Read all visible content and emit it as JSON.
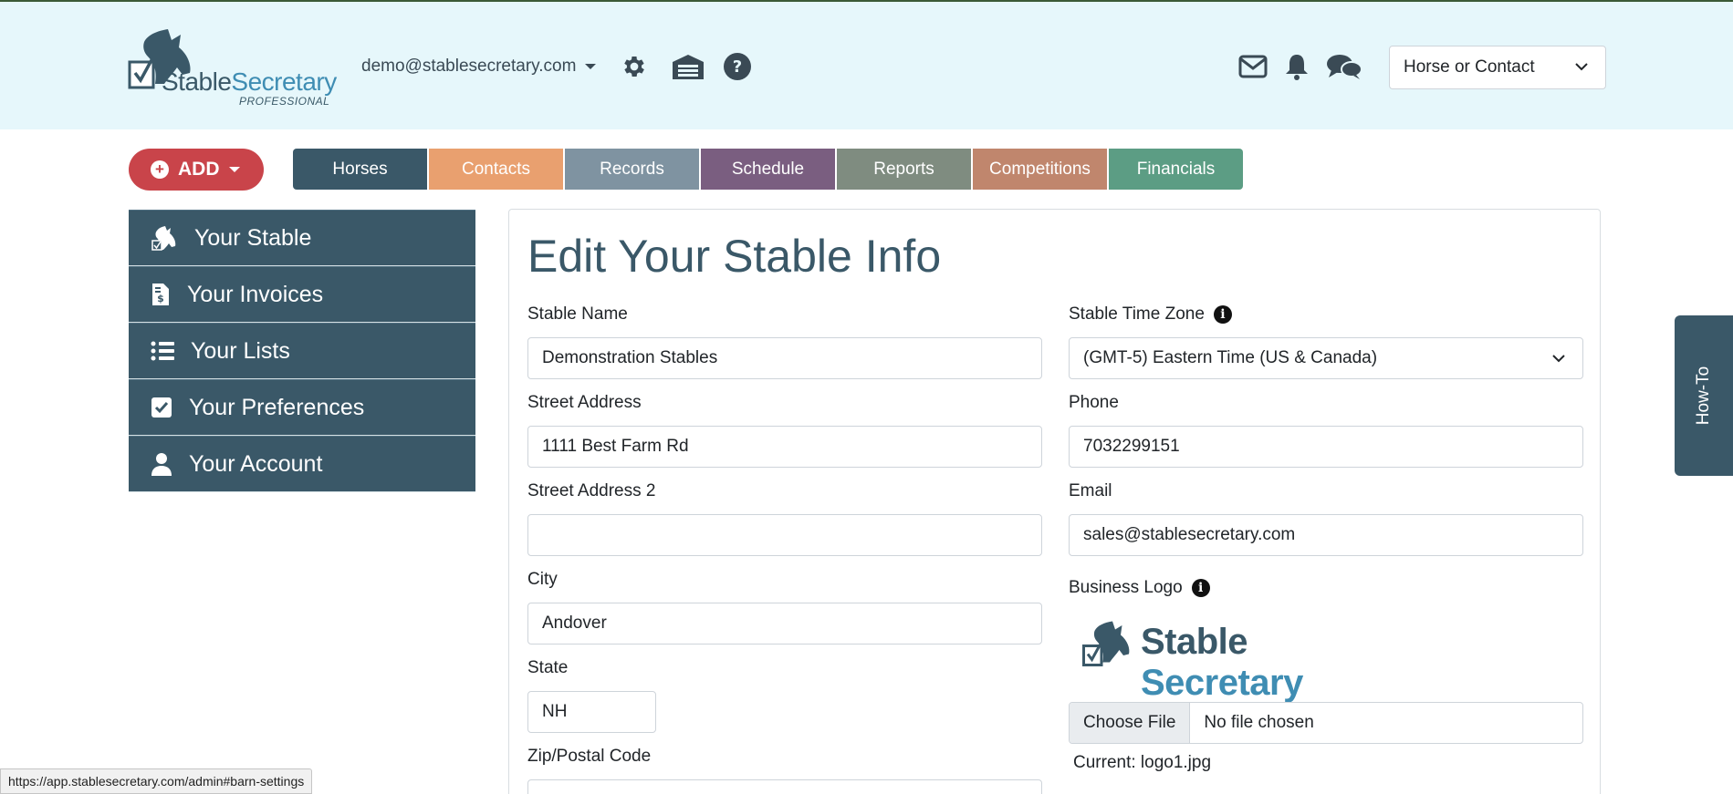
{
  "header": {
    "logo": {
      "part1": "Stable",
      "part2": "Secretary",
      "sub": "PROFESSIONAL"
    },
    "user_email": "demo@stablesecretary.com",
    "search_select": "Horse or Contact"
  },
  "toolbar": {
    "add_label": "ADD",
    "tabs": [
      {
        "label": "Horses",
        "color": "#3a5868"
      },
      {
        "label": "Contacts",
        "color": "#e9a06f"
      },
      {
        "label": "Records",
        "color": "#7f93a1"
      },
      {
        "label": "Schedule",
        "color": "#7a5e80"
      },
      {
        "label": "Reports",
        "color": "#7f8c80"
      },
      {
        "label": "Competitions",
        "color": "#c0866d"
      },
      {
        "label": "Financials",
        "color": "#5c9d84"
      }
    ]
  },
  "sidebar": {
    "items": [
      {
        "label": "Your Stable"
      },
      {
        "label": "Your Invoices"
      },
      {
        "label": "Your Lists"
      },
      {
        "label": "Your Preferences"
      },
      {
        "label": "Your Account"
      }
    ]
  },
  "form": {
    "title": "Edit Your Stable Info",
    "stable_name": {
      "label": "Stable Name",
      "value": "Demonstration Stables"
    },
    "street_address": {
      "label": "Street Address",
      "value": "1111 Best Farm Rd"
    },
    "street_address_2": {
      "label": "Street Address 2",
      "value": ""
    },
    "city": {
      "label": "City",
      "value": "Andover"
    },
    "state": {
      "label": "State",
      "value": "NH"
    },
    "zip": {
      "label": "Zip/Postal Code",
      "value": ""
    },
    "time_zone": {
      "label": "Stable Time Zone",
      "value": "(GMT-5) Eastern Time (US & Canada)"
    },
    "phone": {
      "label": "Phone",
      "value": "7032299151"
    },
    "email": {
      "label": "Email",
      "value": "sales@stablesecretary.com"
    },
    "business_logo": {
      "label": "Business Logo",
      "logo_part1": "Stable",
      "logo_part2": "Secretary",
      "choose_file": "Choose File",
      "no_file": "No file chosen",
      "current": "Current: logo1.jpg"
    }
  },
  "how_to": "How-To",
  "status_bar": "https://app.stablesecretary.com/admin#barn-settings",
  "colors": {
    "header_bg": "#e6f7fb",
    "primary": "#3a5868",
    "add": "#c9444a",
    "brand_blue": "#3f8db3"
  }
}
